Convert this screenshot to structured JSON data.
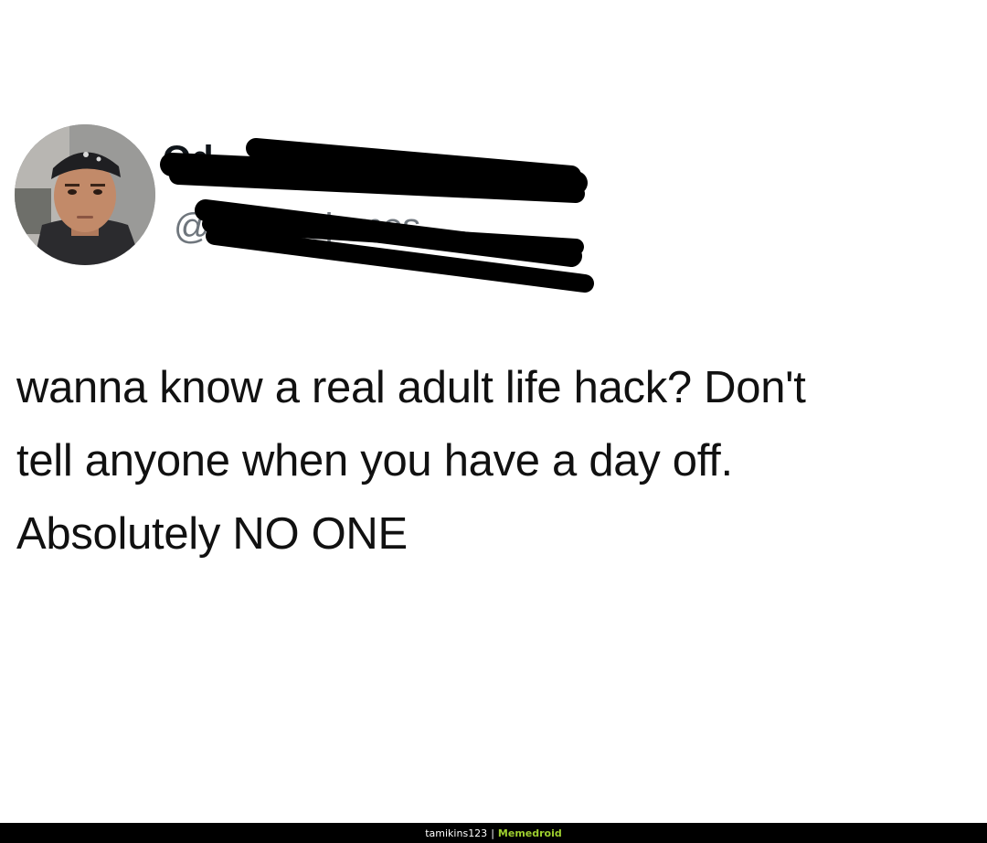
{
  "tweet": {
    "display_name": "Od",
    "handle": "@lalandojames",
    "text_lines": [
      "wanna know a real adult life hack? Don't",
      "tell anyone when you have a day off.",
      "Absolutely NO ONE"
    ]
  },
  "footer": {
    "username": "tamikins123",
    "separator": "|",
    "brand": "Memedroid",
    "brand_color": "#9ecf2f"
  },
  "icons": {
    "avatar": "profile-photo",
    "redaction": "scribble-redaction"
  }
}
